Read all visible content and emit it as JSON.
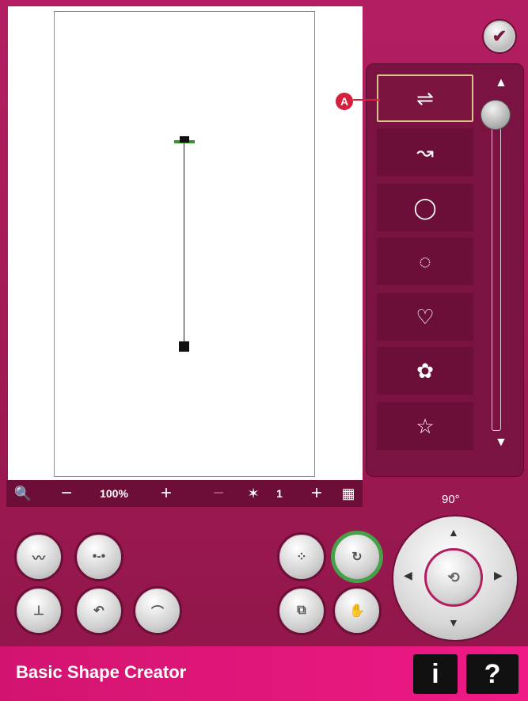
{
  "top": {
    "confirm_icon": "checkmark-icon",
    "confirm_glyph": "✔"
  },
  "canvas": {
    "stitch_start_color": "#3a8f33",
    "stitch_line_color": "#222222"
  },
  "shape_panel": {
    "items": [
      {
        "name": "straight-line",
        "glyph": "⇌"
      },
      {
        "name": "curve",
        "glyph": "↝"
      },
      {
        "name": "circle",
        "glyph": "◯"
      },
      {
        "name": "circle-small",
        "glyph": "◌"
      },
      {
        "name": "heart",
        "glyph": "♡"
      },
      {
        "name": "flower",
        "glyph": "✿"
      },
      {
        "name": "star",
        "glyph": "☆"
      }
    ],
    "selected_index": 0,
    "callout": "A",
    "scroll_up_glyph": "▲",
    "scroll_down_glyph": "▼"
  },
  "toolbar": {
    "zoom_icon": "zoom-options-icon",
    "zoom_glyph": "🔍",
    "minus": "−",
    "zoom_value": "100%",
    "plus": "+",
    "repeat_minus": "−",
    "repeat_icon": "butterfly-icon",
    "repeat_glyph": "✶",
    "repeat_value": "1",
    "repeat_plus": "+",
    "calculator_icon": "calculator-icon",
    "calculator_glyph": "▦"
  },
  "controls": {
    "angle": "90°",
    "buttons": [
      {
        "name": "draw-line-button",
        "glyph": "〰"
      },
      {
        "name": "distribute-button",
        "glyph": "•-•"
      },
      {
        "name": "align-button",
        "glyph": "⊥"
      },
      {
        "name": "undo-shape-button",
        "glyph": "↶"
      },
      {
        "name": "arc-button",
        "glyph": "⌒"
      },
      {
        "name": "select-points-button",
        "glyph": "⁘"
      },
      {
        "name": "rotate-mode-button",
        "glyph": "↻"
      },
      {
        "name": "resize-mode-button",
        "glyph": "⧉"
      },
      {
        "name": "pan-mode-button",
        "glyph": "✋"
      }
    ],
    "wheel_center_glyph": "⟲"
  },
  "footer": {
    "title": "Basic Shape Creator",
    "info_label": "i",
    "help_label": "?"
  }
}
